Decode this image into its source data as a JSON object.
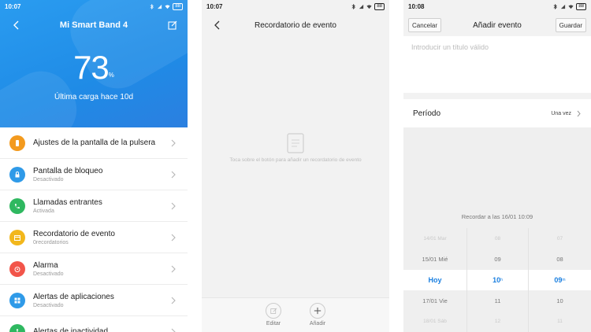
{
  "screen1": {
    "status": {
      "time": "10:07",
      "battery": "88"
    },
    "title": "Mi Smart Band 4",
    "battery_percent": "73",
    "battery_unit": "%",
    "last_charge": "Última carga hace 10d",
    "items": [
      {
        "label": "Ajustes de la pantalla de la pulsera",
        "sub": "",
        "icon": "watch-icon",
        "color": "#f39a1e"
      },
      {
        "label": "Pantalla de bloqueo",
        "sub": "Desactivado",
        "icon": "lock-icon",
        "color": "#2f9ae8"
      },
      {
        "label": "Llamadas entrantes",
        "sub": "Activada",
        "icon": "phone-icon",
        "color": "#2fb860"
      },
      {
        "label": "Recordatorio de evento",
        "sub": "0recordatorios",
        "icon": "calendar-icon",
        "color": "#f2b71c"
      },
      {
        "label": "Alarma",
        "sub": "Desactivado",
        "icon": "alarm-icon",
        "color": "#f2554a"
      },
      {
        "label": "Alertas de aplicaciones",
        "sub": "Desactivado",
        "icon": "apps-icon",
        "color": "#2f9ae8"
      },
      {
        "label": "Alertas de inactividad",
        "sub": "",
        "icon": "inactivity-icon",
        "color": "#2fb860"
      }
    ]
  },
  "screen2": {
    "status": {
      "time": "10:07",
      "battery": "88"
    },
    "title": "Recordatorio de evento",
    "empty_text": "Toca sobre el botón para añadir un recordatorio de evento",
    "edit_label": "Editar",
    "add_label": "Añadir"
  },
  "screen3": {
    "status": {
      "time": "10:08",
      "battery": "88"
    },
    "title": "Añadir evento",
    "cancel_label": "Cancelar",
    "save_label": "Guardar",
    "title_placeholder": "Introducir un título válido",
    "period_label": "Período",
    "period_value": "Una vez",
    "remind_text": "Recordar a las 16/01 10:09",
    "picker": {
      "dates": [
        "14/01 Mar",
        "15/01 Mié",
        "Hoy",
        "17/01 Vie",
        "18/01 Sáb"
      ],
      "hours": [
        "08",
        "09",
        "10",
        "11",
        "12"
      ],
      "minutes": [
        "07",
        "08",
        "09",
        "10",
        "11"
      ],
      "hour_unit": "h",
      "minute_unit": "m"
    }
  },
  "colors": {
    "accent": "#1f8be6",
    "selected": "#1a7fe0"
  }
}
